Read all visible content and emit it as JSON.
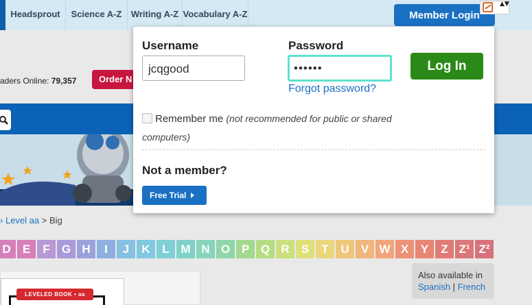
{
  "nav": {
    "tabs": [
      "Headsprout",
      "Science A-Z",
      "Writing A-Z",
      "Vocabulary A-Z"
    ],
    "member_login": "Member Login",
    "util_arrows": "▲▼"
  },
  "page": {
    "readers_label": "aders Online:",
    "readers_count": "79,357",
    "order_label": "Order N",
    "breadcrumb": {
      "sep1": "›",
      "level": "Level aa",
      "sep2": " > ",
      "current": "Big"
    },
    "letters": [
      {
        "label": "D",
        "color": "#d77fb9"
      },
      {
        "label": "E",
        "color": "#d77fb9"
      },
      {
        "label": "F",
        "color": "#b79ad4"
      },
      {
        "label": "G",
        "color": "#a99ad9"
      },
      {
        "label": "H",
        "color": "#9aa2dc"
      },
      {
        "label": "I",
        "color": "#8cb1e0"
      },
      {
        "label": "J",
        "color": "#86c0e3"
      },
      {
        "label": "K",
        "color": "#80c9e0"
      },
      {
        "label": "L",
        "color": "#7fd0d6"
      },
      {
        "label": "M",
        "color": "#80d1c8"
      },
      {
        "label": "N",
        "color": "#87d5ba"
      },
      {
        "label": "O",
        "color": "#8fd6a8"
      },
      {
        "label": "P",
        "color": "#a2d98f"
      },
      {
        "label": "Q",
        "color": "#b6dc82"
      },
      {
        "label": "R",
        "color": "#cbe07c"
      },
      {
        "label": "S",
        "color": "#dfe07a"
      },
      {
        "label": "T",
        "color": "#ebd67b"
      },
      {
        "label": "U",
        "color": "#efc77a"
      },
      {
        "label": "V",
        "color": "#f1b67a"
      },
      {
        "label": "W",
        "color": "#f1a579"
      },
      {
        "label": "X",
        "color": "#ee9277"
      },
      {
        "label": "Y",
        "color": "#e98573"
      },
      {
        "label": "Z",
        "color": "#e27b75"
      },
      {
        "label": "Z¹",
        "color": "#db7778"
      },
      {
        "label": "Z²",
        "color": "#d6737a"
      }
    ],
    "available_in": "Also available in",
    "lang_spanish": "Spanish",
    "lang_sep": " | ",
    "lang_french": "French",
    "book_tag": "LEVELED BOOK • aa"
  },
  "login": {
    "username_label": "Username",
    "username_value": "jcqgood",
    "password_label": "Password",
    "password_value": "••••••",
    "forgot_link": "Forgot password?",
    "login_button": "Log In",
    "remember_label": "Remember me",
    "remember_hint": "(not recommended for public or shared computers)",
    "not_member": "Not a member?",
    "free_trial": "Free Trial"
  },
  "colors": {
    "brand_blue": "#1a70c2",
    "login_green": "#2b8a17",
    "focus_teal": "#5fe0cf",
    "order_red": "#c7163f"
  }
}
